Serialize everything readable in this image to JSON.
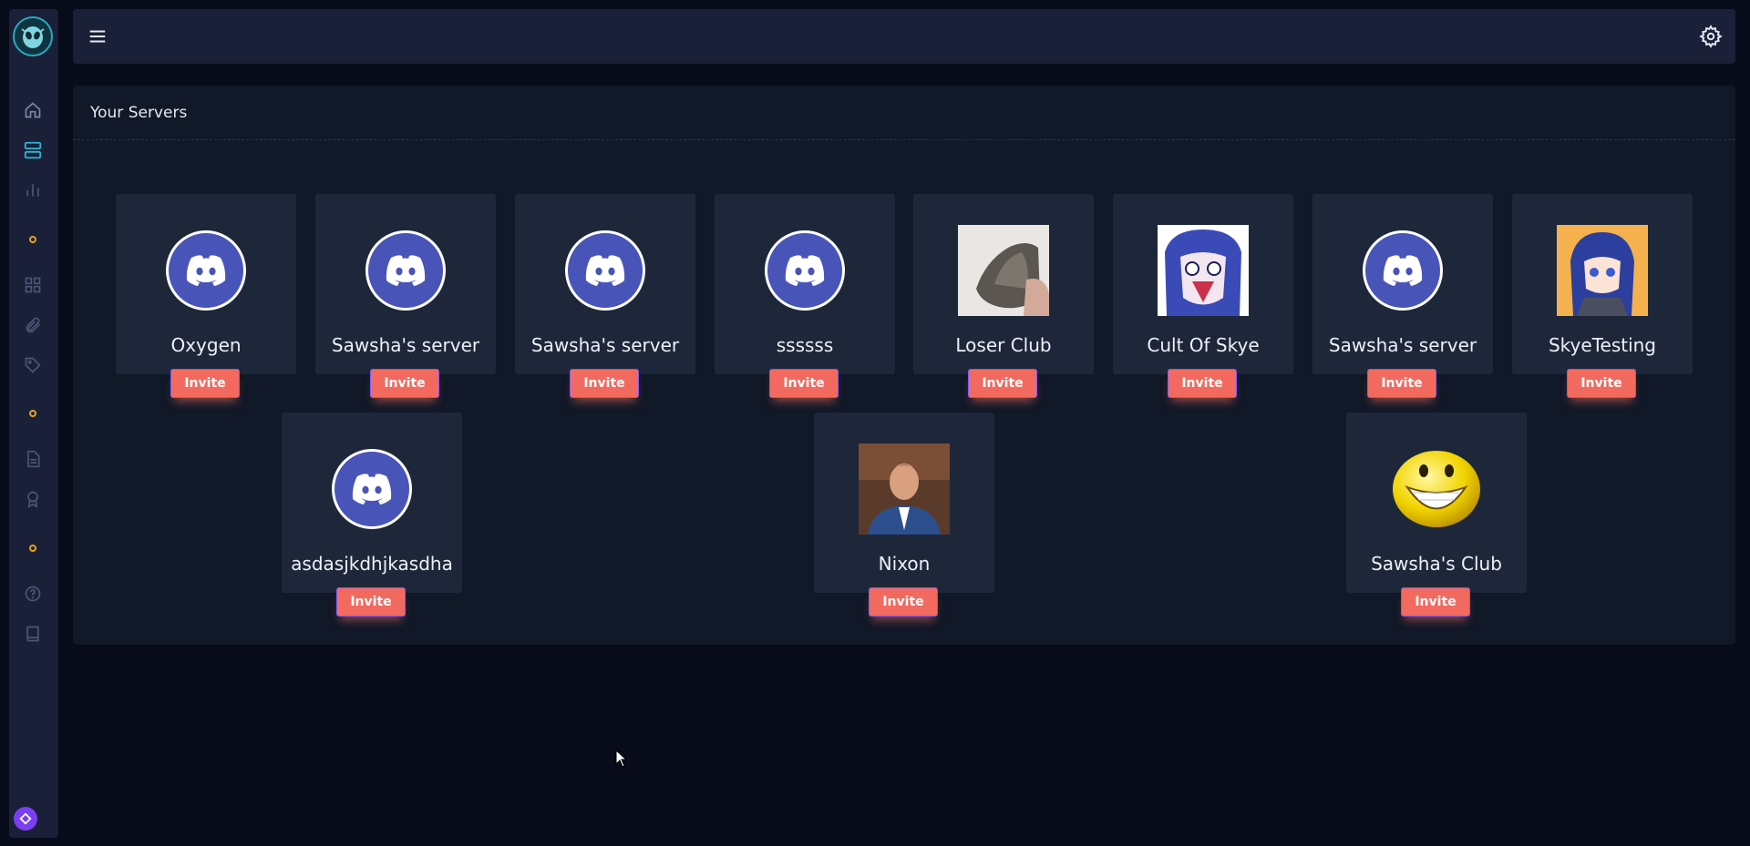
{
  "header": {
    "menu_icon": "hamburger-menu-icon",
    "settings_icon": "gear-icon"
  },
  "sidebar": {
    "logo_icon": "alien-logo-icon",
    "items": [
      {
        "icon": "home-icon"
      },
      {
        "icon": "servers-icon",
        "active": true
      },
      {
        "icon": "bar-chart-icon"
      },
      {
        "icon": "dot-icon"
      },
      {
        "icon": "grid-icon"
      },
      {
        "icon": "paperclip-icon"
      },
      {
        "icon": "tag-icon"
      },
      {
        "icon": "dot-icon"
      },
      {
        "icon": "document-icon"
      },
      {
        "icon": "award-icon"
      },
      {
        "icon": "dot-icon"
      },
      {
        "icon": "help-circle-icon"
      },
      {
        "icon": "book-icon"
      }
    ],
    "bottom_icon": "navigate-icon"
  },
  "panel": {
    "title": "Your Servers"
  },
  "servers": [
    {
      "name": "Oxygen",
      "avatar": "discord-default-icon",
      "invite": "Invite"
    },
    {
      "name": "Sawsha's server",
      "avatar": "discord-default-icon",
      "invite": "Invite"
    },
    {
      "name": "Sawsha's server",
      "avatar": "discord-default-icon",
      "invite": "Invite"
    },
    {
      "name": "ssssss",
      "avatar": "discord-default-icon",
      "invite": "Invite"
    },
    {
      "name": "Loser Club",
      "avatar": "photo-hand-image",
      "invite": "Invite"
    },
    {
      "name": "Cult Of Skye",
      "avatar": "anime-face-image",
      "invite": "Invite"
    },
    {
      "name": "Sawsha's server",
      "avatar": "discord-default-icon",
      "invite": "Invite"
    },
    {
      "name": "SkyeTesting",
      "avatar": "anime-girl-image",
      "invite": "Invite"
    },
    {
      "name": "asdasjkdhjkasdha",
      "avatar": "discord-default-icon",
      "invite": "Invite"
    },
    {
      "name": "Nixon",
      "avatar": "portrait-photo-image",
      "invite": "Invite"
    },
    {
      "name": "Sawsha's Club",
      "avatar": "grinning-smiley-image",
      "invite": "Invite"
    }
  ],
  "colors": {
    "background": "#070b1a",
    "panel": "#111827",
    "card": "#1e273a",
    "invite_button": "#f26a5f",
    "discord_blurple": "#4954b8",
    "sidebar_accent": "#2aa9bf",
    "dot_accent": "#e8a317"
  }
}
